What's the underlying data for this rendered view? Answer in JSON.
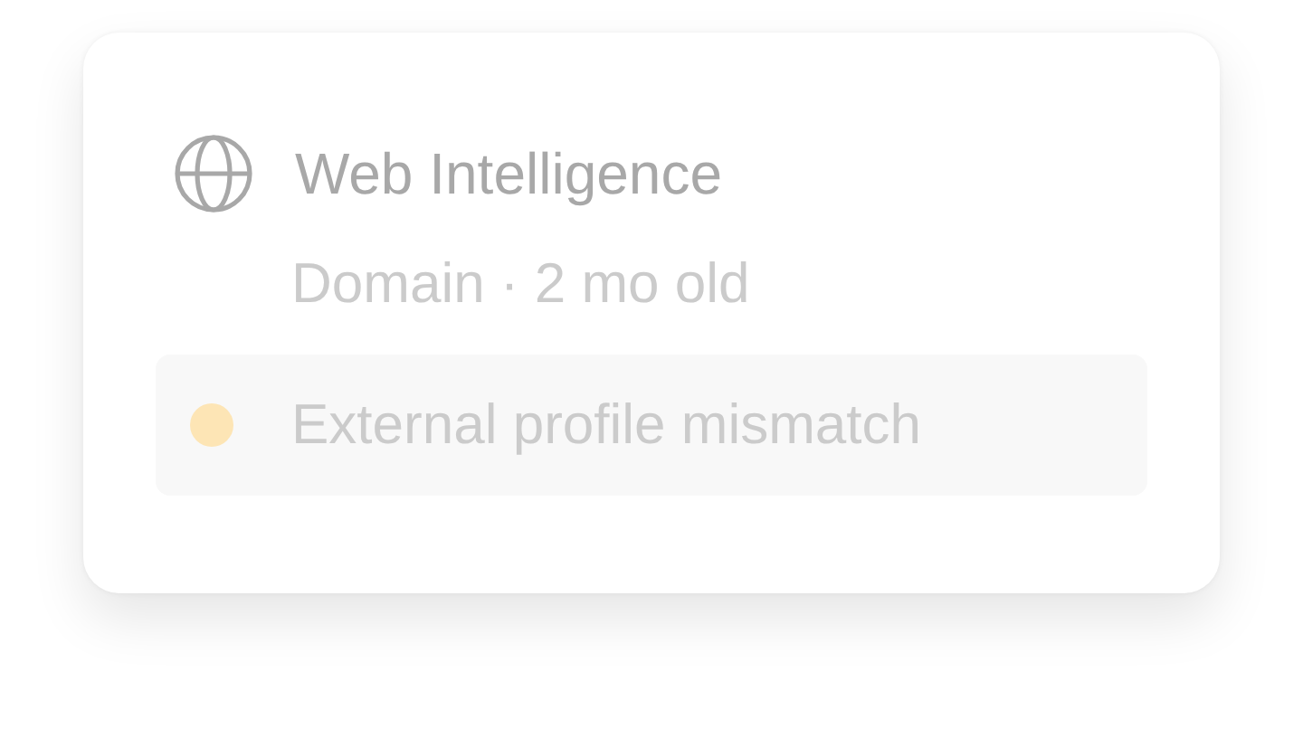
{
  "section": {
    "title": "Web Intelligence",
    "items": [
      {
        "kind": "plain",
        "text": "Domain · 2 mo old"
      },
      {
        "kind": "flag",
        "text": "External profile mismatch",
        "color": "#fde5b5"
      }
    ]
  }
}
